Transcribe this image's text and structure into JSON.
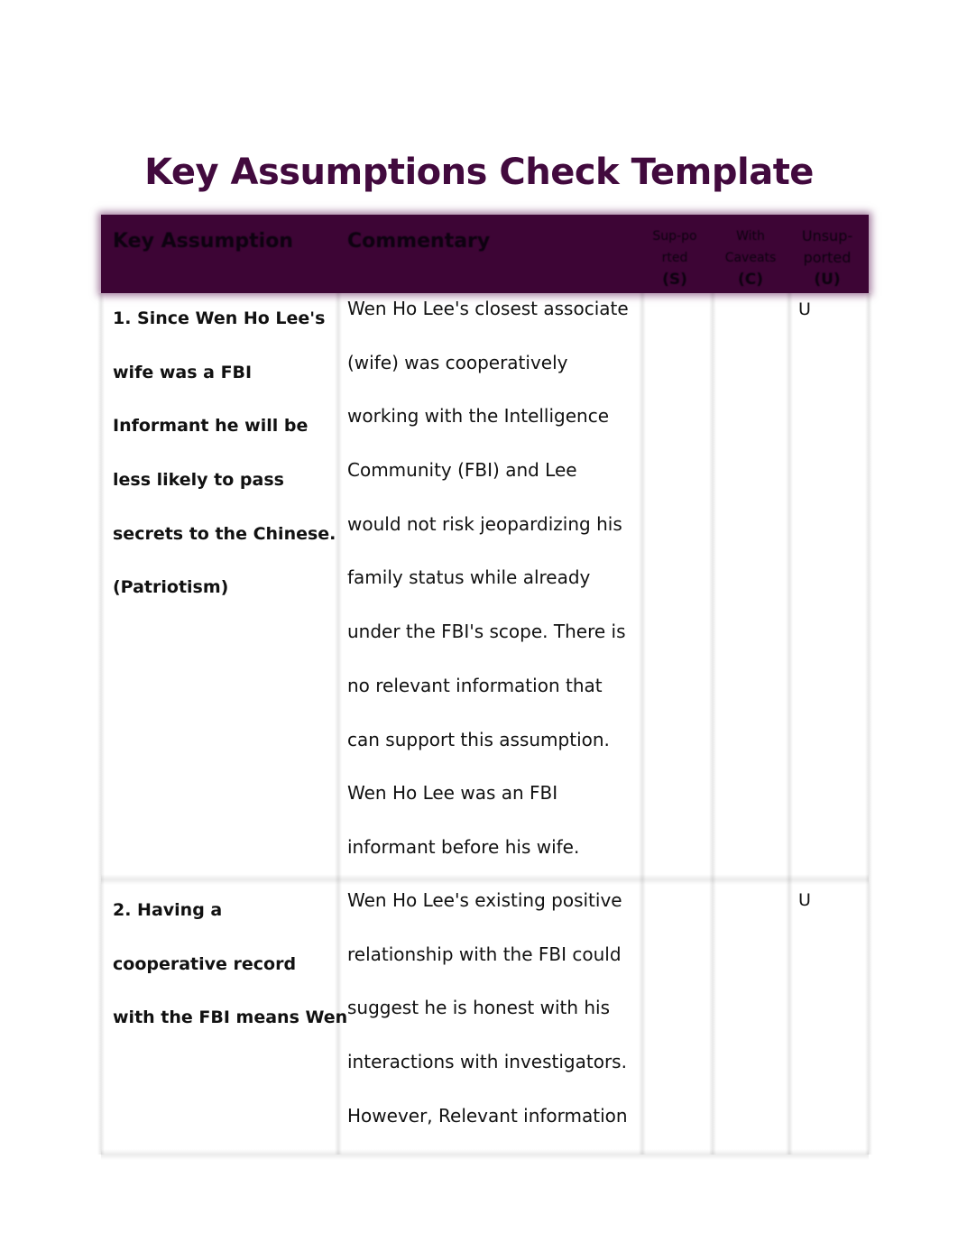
{
  "title": "Key Assumptions Check Template",
  "table": {
    "headers": {
      "assumption": "Key Assumption",
      "commentary": "Commentary",
      "supported": [
        "Sup-po",
        "rted",
        "(S)"
      ],
      "caveats": [
        "With",
        "Caveats",
        "(C)"
      ],
      "unsupported": [
        "Unsup-",
        "ported",
        "(U)"
      ]
    },
    "rows": [
      {
        "assumption_lines": [
          "1. Since Wen Ho Lee's",
          "wife was a FBI",
          "Informant he will be",
          "less likely to pass",
          "secrets to the Chinese.",
          "(Patriotism)"
        ],
        "commentary_lines": [
          "Wen Ho Lee's closest associate",
          "(wife) was cooperatively",
          "working with the Intelligence",
          "Community (FBI) and Lee",
          "would not risk jeopardizing his",
          "family status while already",
          "under the FBI's scope. There is",
          "no relevant information that",
          "can support this assumption.",
          "Wen Ho Lee was an FBI",
          "informant before his wife."
        ],
        "supported": "",
        "caveats": "",
        "unsupported": "U"
      },
      {
        "assumption_lines": [
          "2. Having a",
          "cooperative record",
          "with the FBI means Wen"
        ],
        "commentary_lines": [
          "Wen Ho Lee's existing positive",
          "relationship with the FBI could",
          "suggest he is honest with his",
          "interactions with investigators.",
          "However, Relevant information"
        ],
        "supported": "",
        "caveats": "",
        "unsupported": "U"
      }
    ]
  }
}
